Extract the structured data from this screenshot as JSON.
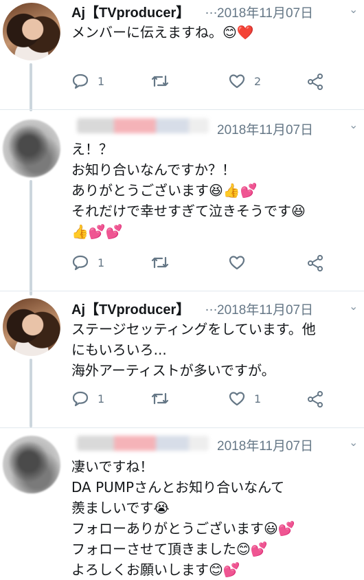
{
  "tweets": [
    {
      "id": "t1",
      "name": "Aj【TVproducer】",
      "dots": "…",
      "date": "2018年11月07日",
      "lines": [
        "メンバーに伝えますね。😊❤️"
      ],
      "counts": {
        "reply": "1",
        "retweet": "",
        "like": "2"
      },
      "blurred": false
    },
    {
      "id": "t2",
      "name": "",
      "date": "2018年11月07日",
      "lines": [
        "え！？",
        "お知り合いなんですか？！",
        "ありがとうございます😆👍💕",
        "それだけで幸せすぎて泣きそうです😆",
        "👍💕💕"
      ],
      "counts": {
        "reply": "1",
        "retweet": "",
        "like": ""
      },
      "blurred": true
    },
    {
      "id": "t3",
      "name": "Aj【TVproducer】",
      "dots": "…",
      "date": "2018年11月07日",
      "lines": [
        "ステージセッティングをしています。他",
        "にもいろいろ...",
        "海外アーティストが多いですが。"
      ],
      "counts": {
        "reply": "1",
        "retweet": "",
        "like": "1"
      },
      "blurred": false
    },
    {
      "id": "t4",
      "name": "",
      "date": "2018年11月07日",
      "lines": [
        "凄いですね！",
        "DA PUMPさんとお知り合いなんて",
        "羨ましいです😭",
        "フォローありがとうございます😃💕",
        "フォローさせて頂きました😊💕",
        "よろしくお願いします😊💕"
      ],
      "counts": {
        "reply": "",
        "retweet": "",
        "like": ""
      },
      "blurred": true
    }
  ],
  "icons": {
    "reply": "reply-icon",
    "retweet": "retweet-icon",
    "like": "heart-icon",
    "share": "share-icon",
    "more": "chevron-down-icon"
  },
  "colors": {
    "text": "#14171a",
    "meta": "#657786",
    "line": "#ccd6dd"
  }
}
